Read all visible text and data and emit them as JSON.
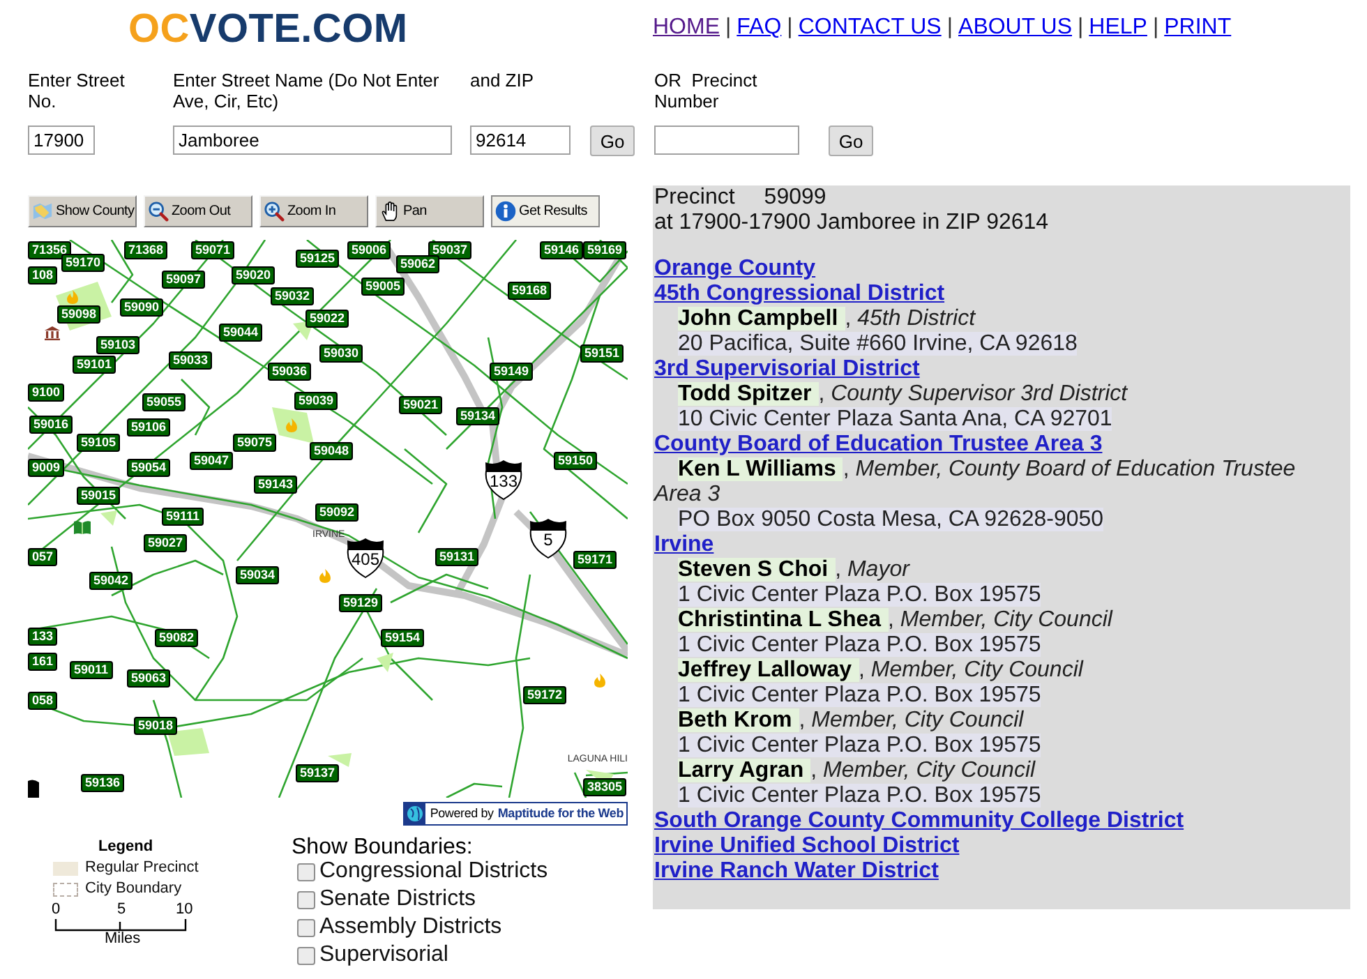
{
  "header": {
    "logo": {
      "accent": "OC",
      "main": "VOTE.COM"
    },
    "nav": [
      {
        "label": "HOME",
        "visited": true
      },
      {
        "divider": "|",
        "label": "FAQ",
        "visited": false
      },
      {
        "divider": "|",
        "label": "CONTACT US",
        "visited": false
      },
      {
        "divider": "|",
        "label": "ABOUT US",
        "visited": false
      },
      {
        "divider": "|",
        "label": "HELP",
        "visited": false
      },
      {
        "divider": "|",
        "label": "PRINT",
        "visited": false
      }
    ]
  },
  "search_form": {
    "street_no": {
      "label": "Enter Street No.",
      "value": "17900"
    },
    "street_name": {
      "label": "Enter Street Name (Do Not Enter Ave, Cir, Etc)",
      "value": "Jamboree"
    },
    "zip": {
      "label": "and ZIP",
      "value": "92614"
    },
    "address_go": "Go",
    "precinct": {
      "label": "OR  Precinct Number"
    },
    "precinct_go": "Go"
  },
  "map_toolbar": [
    {
      "kind": "county",
      "label": "Show County",
      "selected": false
    },
    {
      "kind": "zoomout",
      "label": "Zoom Out",
      "selected": false
    },
    {
      "kind": "zoomin",
      "label": "Zoom In",
      "selected": false
    },
    {
      "kind": "pan",
      "label": "Pan",
      "selected": false
    },
    {
      "kind": "info",
      "label": "Get Results",
      "selected": true
    }
  ],
  "map": {
    "precinct_labels": [
      "71356",
      "71368",
      "59071",
      "59006",
      "59037",
      "59146",
      "59169",
      "59170",
      "108",
      "59125",
      "59062",
      "59097",
      "59020",
      "59032",
      "59005",
      "59168",
      "59098",
      "59090",
      "59022",
      "59044",
      "59103",
      "59101",
      "59033",
      "59030",
      "59036",
      "59151",
      "59149",
      "9100",
      "59055",
      "59039",
      "59021",
      "59134",
      "59016",
      "59106",
      "59105",
      "59075",
      "59048",
      "9009",
      "59054",
      "59047",
      "59150",
      "59143",
      "59015",
      "59111",
      "59092",
      "59027",
      "057",
      "59131",
      "59171",
      "59042",
      "59034",
      "59129",
      "133",
      "59082",
      "59154",
      "161",
      "59011",
      "59063",
      "058",
      "59172",
      "59018",
      "59137",
      "59136",
      "38305"
    ],
    "place_labels": [
      "IRVINE",
      "LAGUNA HILI"
    ],
    "highway_shields": [
      "133",
      "405",
      "5"
    ],
    "credit": {
      "prefix": "Powered by",
      "product": "Maptitude for the Web"
    }
  },
  "legend": {
    "title": "Legend",
    "items": [
      {
        "kind": "fill",
        "label": "Regular Precinct"
      },
      {
        "kind": "dashed",
        "label": "City Boundary"
      }
    ],
    "scale": {
      "ticks": [
        "0",
        "5",
        "10"
      ],
      "unit": "Miles"
    }
  },
  "boundaries": {
    "title": "Show Boundaries:",
    "options": [
      {
        "label": "Congressional Districts",
        "checked": false
      },
      {
        "label": "Senate Districts",
        "checked": false
      },
      {
        "label": "Assembly Districts",
        "checked": false
      },
      {
        "label": "Supervisorial",
        "checked": false
      }
    ]
  },
  "results": {
    "precinct": {
      "label": "Precinct",
      "number": "59099"
    },
    "location": "at 17900-17900 Jamboree in ZIP 92614",
    "districts": [
      {
        "name": "Orange County"
      },
      {
        "name": "45th Congressional District",
        "officials": [
          {
            "name": "John Campbell",
            "title": ", *45th District*",
            "address": "20 Pacifica, Suite #660 Irvine, CA 92618"
          }
        ]
      },
      {
        "name": "3rd Supervisorial District",
        "officials": [
          {
            "name": "Todd Spitzer",
            "title": ", *County Supervisor 3rd District*",
            "address": "10 Civic Center Plaza Santa Ana, CA 92701"
          }
        ]
      },
      {
        "name": "County Board of Education Trustee Area 3",
        "officials": [
          {
            "name": "Ken L Williams",
            "title": ", *Member, County Board of Education Trustee Area 3*",
            "address": "PO Box 9050 Costa Mesa, CA 92628-9050"
          }
        ]
      },
      {
        "name": "Irvine",
        "officials": [
          {
            "name": "Steven S Choi",
            "title": ", *Mayor*",
            "address": "1 Civic Center Plaza P.O. Box 19575"
          },
          {
            "name": "Christintina L Shea",
            "title": ", *Member, City Council*",
            "address": "1 Civic Center Plaza P.O. Box 19575"
          },
          {
            "name": "Jeffrey Lalloway",
            "title": ", *Member, City Council*",
            "address": "1 Civic Center Plaza P.O. Box 19575"
          },
          {
            "name": "Beth Krom",
            "title": ", *Member, City Council*",
            "address": "1 Civic Center Plaza P.O. Box 19575"
          },
          {
            "name": "Larry Agran",
            "title": ", *Member, City Council*",
            "address": "1 Civic Center Plaza P.O. Box 19575"
          }
        ]
      },
      {
        "name": "South Orange County Community College District"
      },
      {
        "name": "Irvine Unified School District"
      },
      {
        "name": "Irvine Ranch Water District"
      }
    ]
  }
}
